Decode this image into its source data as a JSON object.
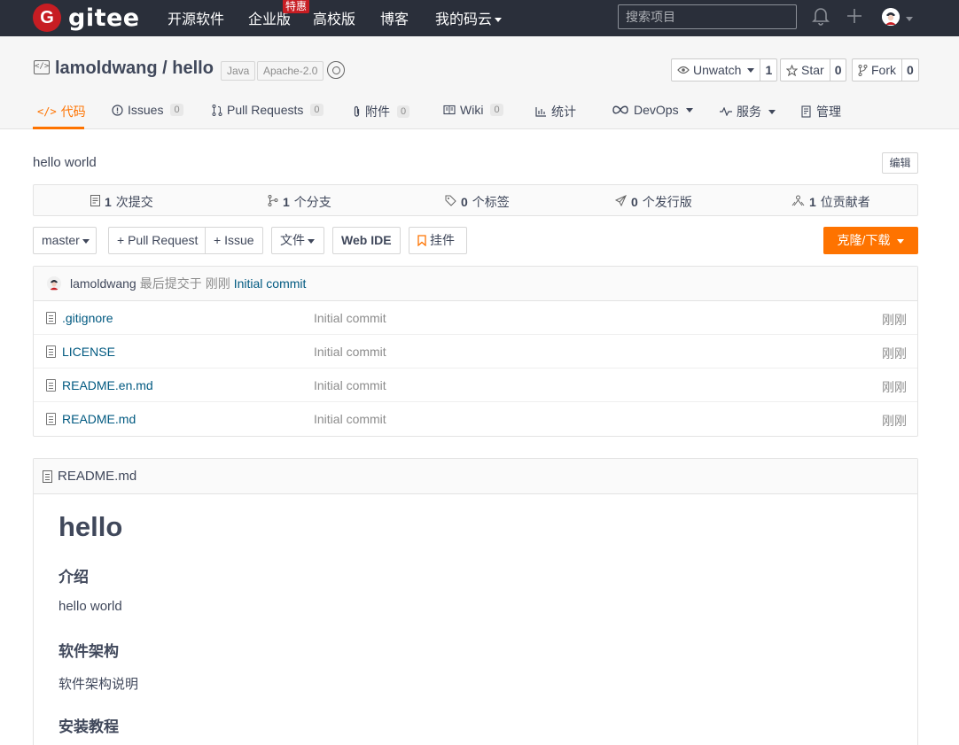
{
  "topnav": {
    "brand": "gitee",
    "links": [
      "开源软件",
      "企业版",
      "高校版",
      "博客",
      "我的码云"
    ],
    "badge": "特惠",
    "search_placeholder": "搜索项目"
  },
  "repo": {
    "owner": "lamoldwang",
    "separator": " / ",
    "name": "hello",
    "language": "Java",
    "license": "Apache-2.0",
    "watch": {
      "label": "Unwatch",
      "count": "1"
    },
    "star": {
      "label": "Star",
      "count": "0"
    },
    "fork": {
      "label": "Fork",
      "count": "0"
    }
  },
  "tabs": [
    {
      "label": "代码"
    },
    {
      "label": "Issues",
      "count": "0"
    },
    {
      "label": "Pull Requests",
      "count": "0"
    },
    {
      "label": "附件",
      "count": "0"
    },
    {
      "label": "Wiki",
      "count": "0"
    },
    {
      "label": "统计"
    },
    {
      "label": "DevOps"
    },
    {
      "label": "服务"
    },
    {
      "label": "管理"
    }
  ],
  "description": "hello world",
  "edit_label": "编辑",
  "stats": [
    {
      "num": "1",
      "label": "次提交"
    },
    {
      "num": "1",
      "label": "个分支"
    },
    {
      "num": "0",
      "label": "个标签"
    },
    {
      "num": "0",
      "label": "个发行版"
    },
    {
      "num": "1",
      "label": "位贡献者"
    }
  ],
  "toolbar": {
    "branch": "master",
    "pull_request": "+ Pull Request",
    "issue": "+ Issue",
    "file": "文件",
    "web_ide": "Web IDE",
    "widget": "挂件",
    "clone": "克隆/下载"
  },
  "last_commit": {
    "author": "lamoldwang",
    "text": "最后提交于",
    "time": "刚刚",
    "message": "Initial commit"
  },
  "files": [
    {
      "name": ".gitignore",
      "message": "Initial commit",
      "time": "刚刚"
    },
    {
      "name": "LICENSE",
      "message": "Initial commit",
      "time": "刚刚"
    },
    {
      "name": "README.en.md",
      "message": "Initial commit",
      "time": "刚刚"
    },
    {
      "name": "README.md",
      "message": "Initial commit",
      "time": "刚刚"
    }
  ],
  "readme": {
    "filename": "README.md",
    "h1": "hello",
    "sections": [
      {
        "heading": "介绍",
        "body": "hello world"
      },
      {
        "heading": "软件架构",
        "body": "软件架构说明"
      },
      {
        "heading": "安装教程"
      }
    ]
  }
}
